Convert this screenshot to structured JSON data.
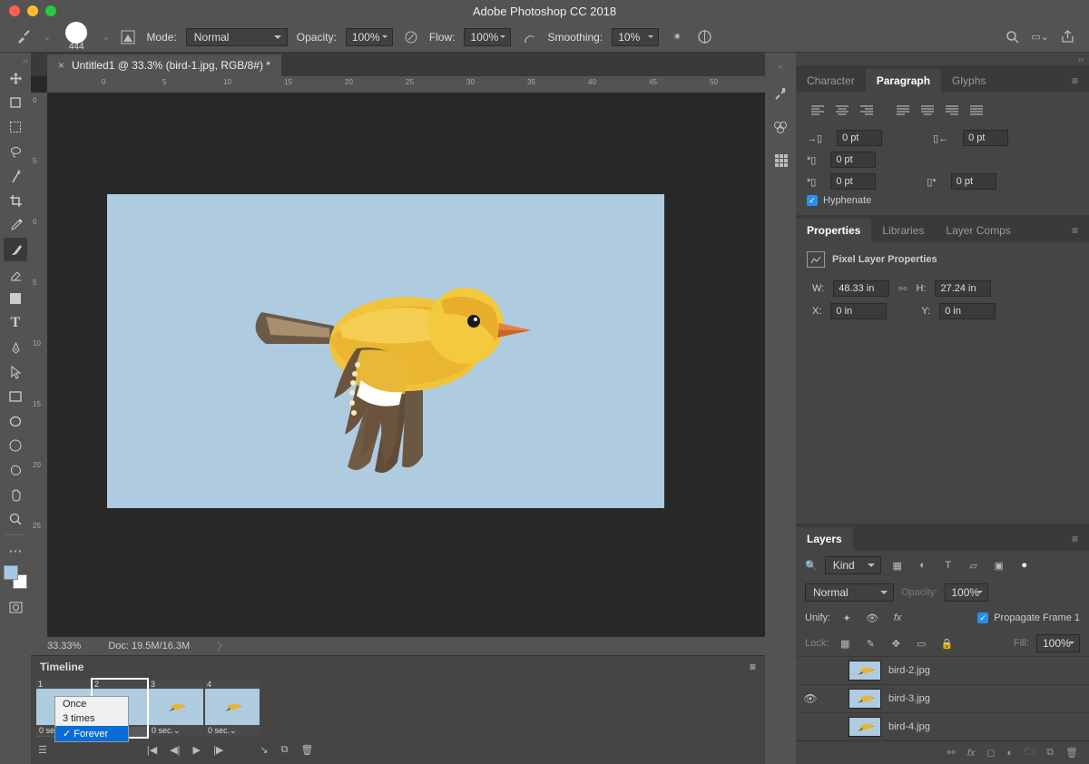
{
  "app": {
    "title": "Adobe Photoshop CC 2018"
  },
  "options": {
    "brush_size": "444",
    "mode_label": "Mode:",
    "mode_value": "Normal",
    "opacity_label": "Opacity:",
    "opacity_value": "100%",
    "flow_label": "Flow:",
    "flow_value": "100%",
    "smoothing_label": "Smoothing:",
    "smoothing_value": "10%"
  },
  "document": {
    "tab_title": "Untitled1 @ 33.3% (bird-1.jpg, RGB/8#) *",
    "zoom": "33.33%",
    "doc_info": "Doc: 19.5M/16.3M",
    "ruler_x": [
      "0",
      "5",
      "10",
      "15",
      "20",
      "25",
      "30",
      "35",
      "40",
      "45",
      "50"
    ],
    "ruler_y": [
      "0",
      "5",
      "0",
      "5",
      "10",
      "15",
      "20",
      "25"
    ]
  },
  "timeline": {
    "title": "Timeline",
    "frames": [
      {
        "n": "1",
        "dur": "0 se"
      },
      {
        "n": "2",
        "dur": ""
      },
      {
        "n": "3",
        "dur": "0 sec.⌄"
      },
      {
        "n": "4",
        "dur": "0 sec.⌄"
      }
    ],
    "loop_options": [
      "Once",
      "3 times",
      "Forever"
    ],
    "loop_selected": "Forever"
  },
  "paragraph": {
    "tabs": [
      "Character",
      "Paragraph",
      "Glyphs"
    ],
    "indent_left": "0 pt",
    "indent_right": "0 pt",
    "indent_first": "0 pt",
    "space_before": "0 pt",
    "space_after": "0 pt",
    "hyphenate_label": "Hyphenate"
  },
  "properties": {
    "tabs": [
      "Properties",
      "Libraries",
      "Layer Comps"
    ],
    "heading": "Pixel Layer Properties",
    "w_label": "W:",
    "w_value": "48.33 in",
    "h_label": "H:",
    "h_value": "27.24 in",
    "x_label": "X:",
    "x_value": "0 in",
    "y_label": "Y:",
    "y_value": "0 in"
  },
  "layers": {
    "title": "Layers",
    "kind_label": "Kind",
    "blend_mode": "Normal",
    "opacity_label": "Opacity:",
    "opacity_value": "100%",
    "unify_label": "Unify:",
    "propagate_label": "Propagate Frame 1",
    "lock_label": "Lock:",
    "fill_label": "Fill:",
    "fill_value": "100%",
    "items": [
      {
        "name": "bird-2.jpg",
        "visible": false
      },
      {
        "name": "bird-3.jpg",
        "visible": true
      },
      {
        "name": "bird-4.jpg",
        "visible": false
      }
    ]
  }
}
